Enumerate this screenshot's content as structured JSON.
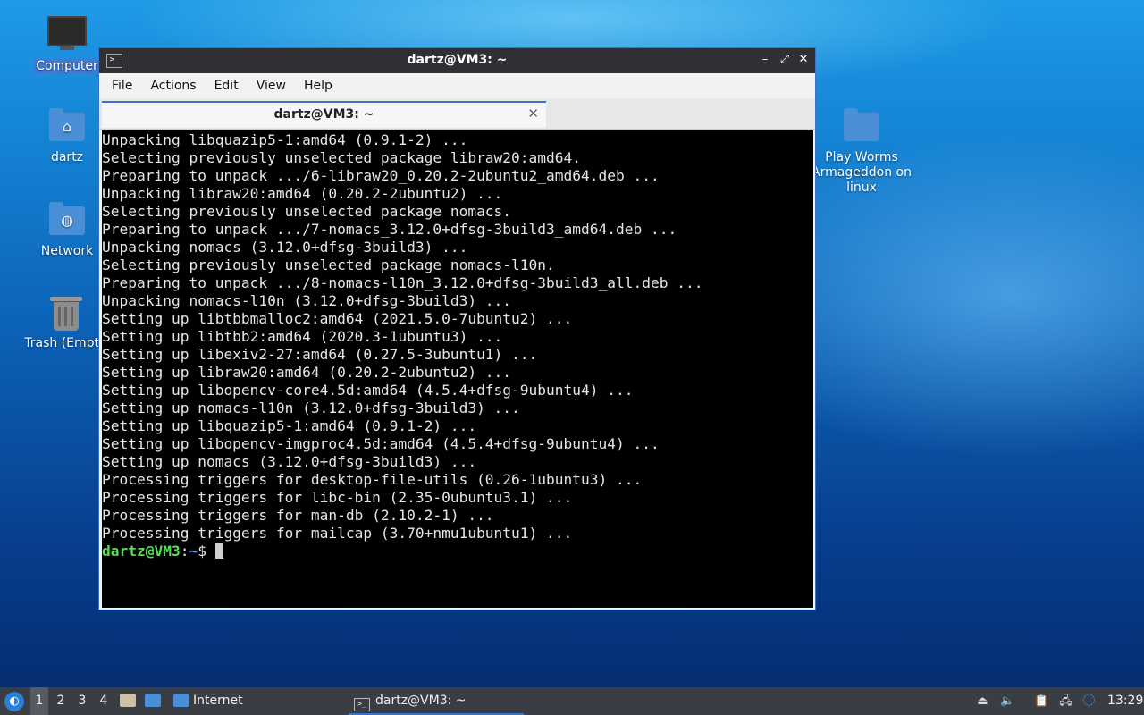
{
  "desktop": {
    "icons": [
      {
        "label": "Computer"
      },
      {
        "label": "dartz"
      },
      {
        "label": "Network"
      },
      {
        "label": "Trash (Empty)"
      },
      {
        "label": "Play Worms Armageddon on linux"
      }
    ]
  },
  "window": {
    "title": "dartz@VM3: ~",
    "menu": [
      "File",
      "Actions",
      "Edit",
      "View",
      "Help"
    ],
    "tab_title": "dartz@VM3: ~",
    "terminal_lines": [
      "Unpacking libquazip5-1:amd64 (0.9.1-2) ...",
      "Selecting previously unselected package libraw20:amd64.",
      "Preparing to unpack .../6-libraw20_0.20.2-2ubuntu2_amd64.deb ...",
      "Unpacking libraw20:amd64 (0.20.2-2ubuntu2) ...",
      "Selecting previously unselected package nomacs.",
      "Preparing to unpack .../7-nomacs_3.12.0+dfsg-3build3_amd64.deb ...",
      "Unpacking nomacs (3.12.0+dfsg-3build3) ...",
      "Selecting previously unselected package nomacs-l10n.",
      "Preparing to unpack .../8-nomacs-l10n_3.12.0+dfsg-3build3_all.deb ...",
      "Unpacking nomacs-l10n (3.12.0+dfsg-3build3) ...",
      "Setting up libtbbmalloc2:amd64 (2021.5.0-7ubuntu2) ...",
      "Setting up libtbb2:amd64 (2020.3-1ubuntu3) ...",
      "Setting up libexiv2-27:amd64 (0.27.5-3ubuntu1) ...",
      "Setting up libraw20:amd64 (0.20.2-2ubuntu2) ...",
      "Setting up libopencv-core4.5d:amd64 (4.5.4+dfsg-9ubuntu4) ...",
      "Setting up nomacs-l10n (3.12.0+dfsg-3build3) ...",
      "Setting up libquazip5-1:amd64 (0.9.1-2) ...",
      "Setting up libopencv-imgproc4.5d:amd64 (4.5.4+dfsg-9ubuntu4) ...",
      "Setting up nomacs (3.12.0+dfsg-3build3) ...",
      "Processing triggers for desktop-file-utils (0.26-1ubuntu3) ...",
      "Processing triggers for libc-bin (2.35-0ubuntu3.1) ...",
      "Processing triggers for man-db (2.10.2-1) ...",
      "Processing triggers for mailcap (3.70+nmu1ubuntu1) ..."
    ],
    "prompt": {
      "user_host": "dartz@VM3",
      "sep": ":",
      "path": "~",
      "symbol": "$ "
    }
  },
  "taskbar": {
    "workspaces": [
      "1",
      "2",
      "3",
      "4"
    ],
    "active_workspace": "1",
    "quicklaunch_label": "Internet",
    "task_title": "dartz@VM3: ~",
    "clock": "13:29"
  },
  "colors": {
    "accent": "#3b73c8",
    "prompt_user": "#55e055",
    "prompt_path": "#5a9cf5"
  }
}
